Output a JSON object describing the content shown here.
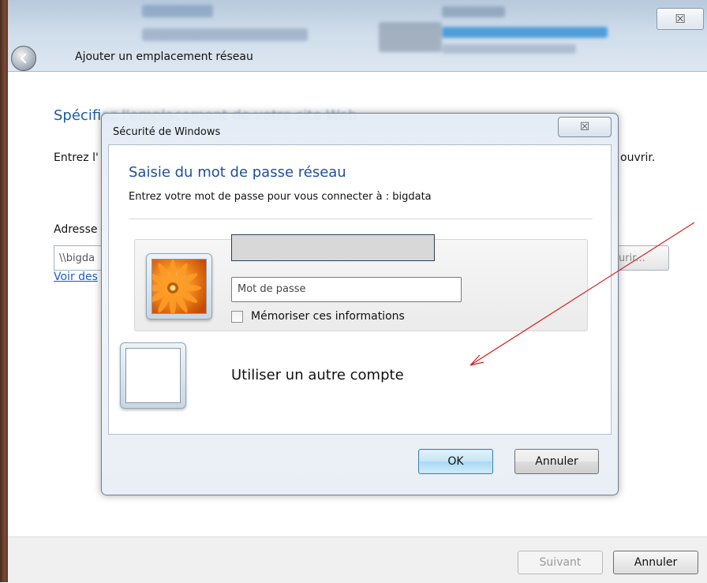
{
  "wizard": {
    "title": "Ajouter un emplacement réseau",
    "heading_start": "Spécifi",
    "heading_rest": "ez l'emplacement de votre site Web",
    "instruction_start": "Entrez l'",
    "instruction_end": "ouvrir.",
    "address_label": "Adresse",
    "address_value": "\\\\bigda",
    "browse_label": "urir...",
    "link_label": "Voir des",
    "next_label": "Suivant",
    "cancel_label": "Annuler",
    "close_glyph": "☒"
  },
  "dialog": {
    "title": "Sécurité de Windows",
    "close_glyph": "☒",
    "heading": "Saisie du mot de passe réseau",
    "subtitle": "Entrez votre mot de passe pour vous connecter à : bigdata",
    "username_value": "",
    "password_placeholder": "Mot de passe",
    "remember_label": "Mémoriser ces informations",
    "other_account_label": "Utiliser un autre compte",
    "ok_label": "OK",
    "cancel_label": "Annuler"
  },
  "colors": {
    "heading_blue": "#1e4f99",
    "annotation_red": "#d62020"
  }
}
